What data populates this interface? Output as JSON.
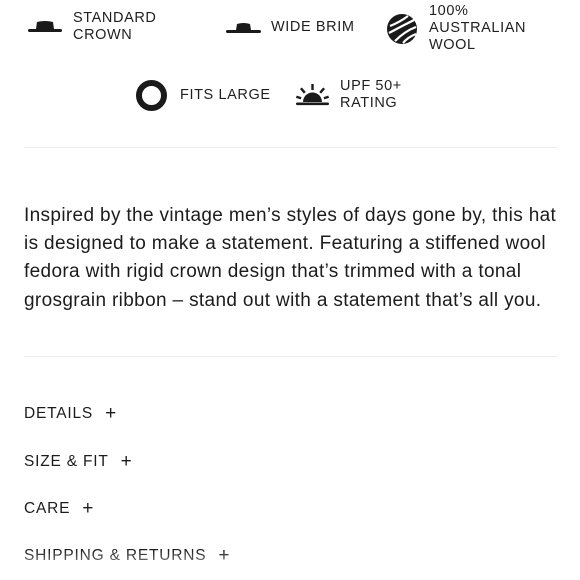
{
  "features": [
    {
      "icon": "hat-standard-crown-icon",
      "label": "STANDARD\nCROWN"
    },
    {
      "icon": "hat-wide-brim-icon",
      "label": "WIDE BRIM"
    },
    {
      "icon": "yarn-ball-icon",
      "label": "100%\nAUSTRALIAN\nWOOL"
    },
    {
      "icon": "ring-icon",
      "label": "FITS LARGE"
    },
    {
      "icon": "sun-icon",
      "label": "UPF 50+\nRATING"
    }
  ],
  "description": "Inspired by the vintage men’s styles of days gone by, this hat is designed to make a statement. Featuring a stiffened wool fedora with rigid crown design that’s trimmed with a tonal grosgrain ribbon – stand out with a statement that’s all you.",
  "accordion": [
    {
      "label": "DETAILS",
      "icon": "plus"
    },
    {
      "label": "SIZE & FIT",
      "icon": "plus"
    },
    {
      "label": "CARE",
      "icon": "plus"
    },
    {
      "label": "SHIPPING & RETURNS",
      "icon": "plus"
    }
  ]
}
